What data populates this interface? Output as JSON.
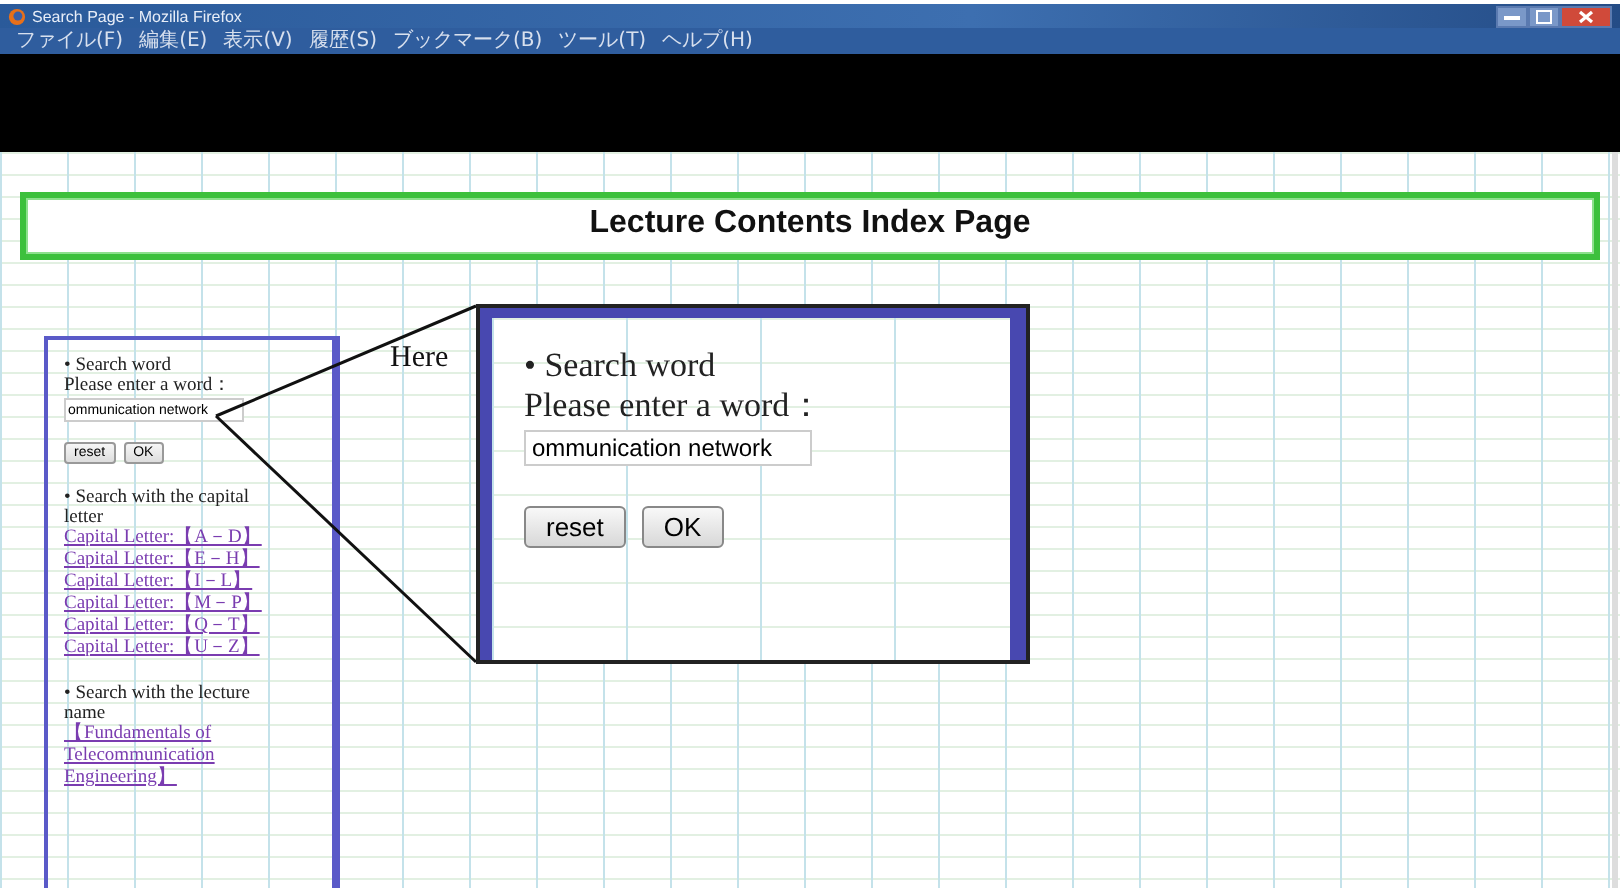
{
  "window": {
    "title": "Search Page - Mozilla Firefox"
  },
  "menu": [
    "ファイル(F)",
    "編集(E)",
    "表示(V)",
    "履歴(S)",
    "ブックマーク(B)",
    "ツール(T)",
    "ヘルプ(H)"
  ],
  "page": {
    "heading": "Lecture Contents Index Page"
  },
  "sidebar": {
    "search_word": {
      "label": "• Search word",
      "prompt": "Please enter a word：",
      "value": "ommunication network",
      "buttons": [
        "reset",
        "OK"
      ]
    },
    "capital": {
      "label": "• Search with the capital letter",
      "links": [
        "Capital Letter:【A－D】",
        "Capital Letter:【E－H】",
        "Capital Letter:【I－L】",
        "Capital Letter:【M－P】",
        "Capital Letter:【Q－T】",
        "Capital Letter:【U－Z】"
      ]
    },
    "lecture": {
      "label": "• Search with the lecture name",
      "links": [
        "【Fundamentals of Telecommunication Engineering】"
      ]
    }
  },
  "callout": {
    "pointer": "Here",
    "label": "• Search word",
    "prompt": "Please enter a word：",
    "value": "ommunication network",
    "buttons": [
      "reset",
      "OK"
    ]
  }
}
